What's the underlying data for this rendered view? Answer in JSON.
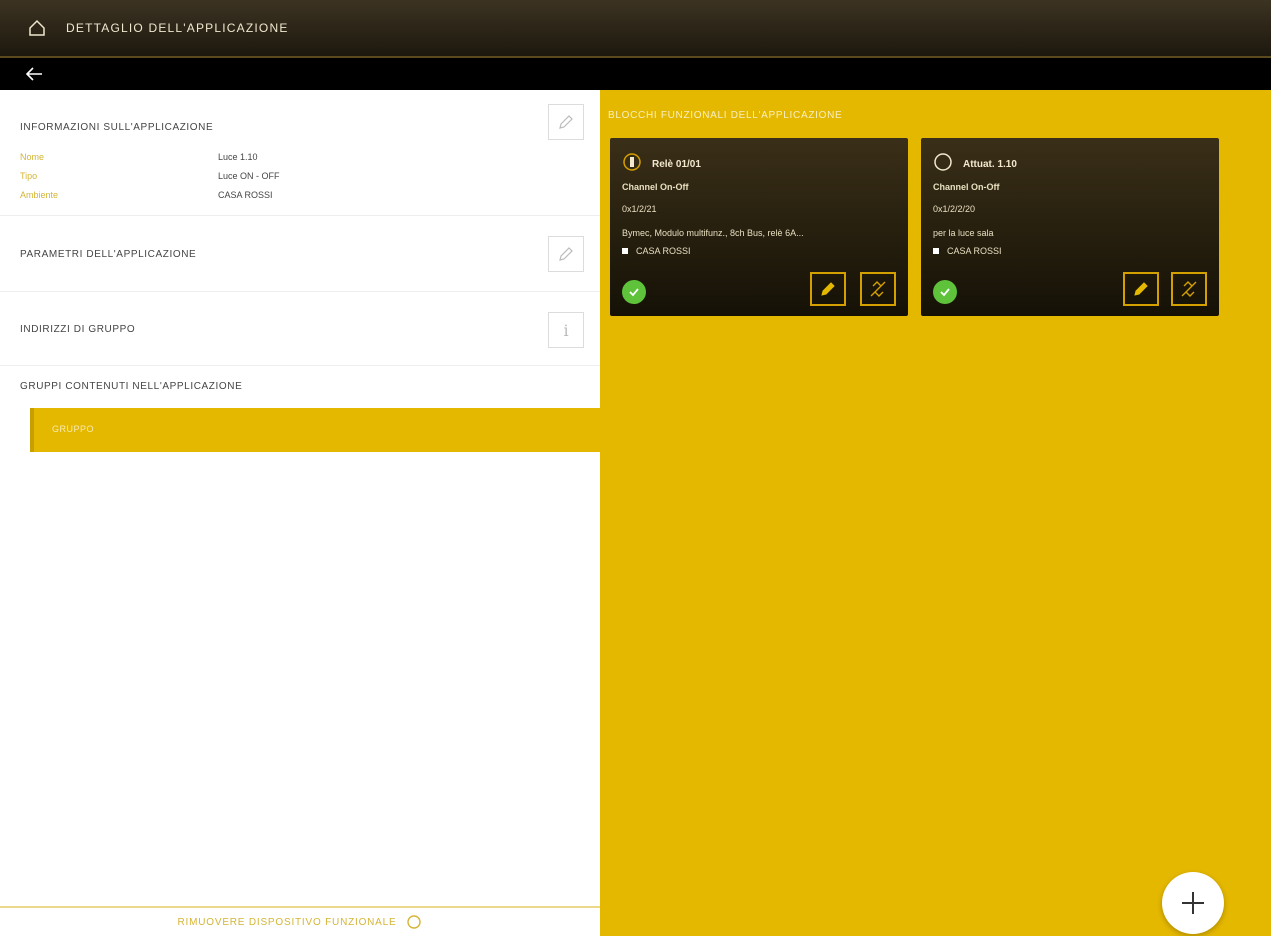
{
  "header": {
    "title": "DETTAGLIO DELL'APPLICAZIONE",
    "home_icon": "home-icon",
    "back_icon": "back-arrow-icon"
  },
  "left_panel": {
    "info_section": {
      "title": "INFORMAZIONI SULL'APPLICAZIONE",
      "rows": [
        {
          "key": "Nome",
          "value": "Luce 1.10"
        },
        {
          "key": "Tipo",
          "value": "Luce ON - OFF"
        },
        {
          "key": "Ambiente",
          "value": "CASA ROSSI"
        }
      ]
    },
    "params_section": {
      "title": "PARAMETRI DELL'APPLICAZIONE"
    },
    "group_address_section": {
      "title": "INDIRIZZI DI GRUPPO"
    },
    "groups_section": {
      "title": "GRUPPI CONTENUTI NELL'APPLICAZIONE",
      "items": [
        {
          "label": "GRUPPO"
        }
      ]
    },
    "footer": {
      "label": "RIMUOVERE DISPOSITIVO FUNZIONALE"
    }
  },
  "right_panel": {
    "title": "BLOCCHI FUNZIONALI DELL'APPLICAZIONE",
    "cards": [
      {
        "name": "Relè 01/01",
        "channel": "Channel On-Off",
        "code": "0x1/2/21",
        "description": "Bymec, Modulo multifunz., 8ch Bus, relè 6A...",
        "location": "CASA ROSSI"
      },
      {
        "name": "Attuat. 1.10",
        "channel": "Channel On-Off",
        "code": "0x1/2/2/20",
        "description": "per la luce sala",
        "location": "CASA ROSSI"
      }
    ]
  },
  "fab": {
    "icon": "plus-icon"
  },
  "colors": {
    "accent": "#e5b800",
    "header_dark": "#2a2416",
    "status_ok": "#5ec23a"
  }
}
